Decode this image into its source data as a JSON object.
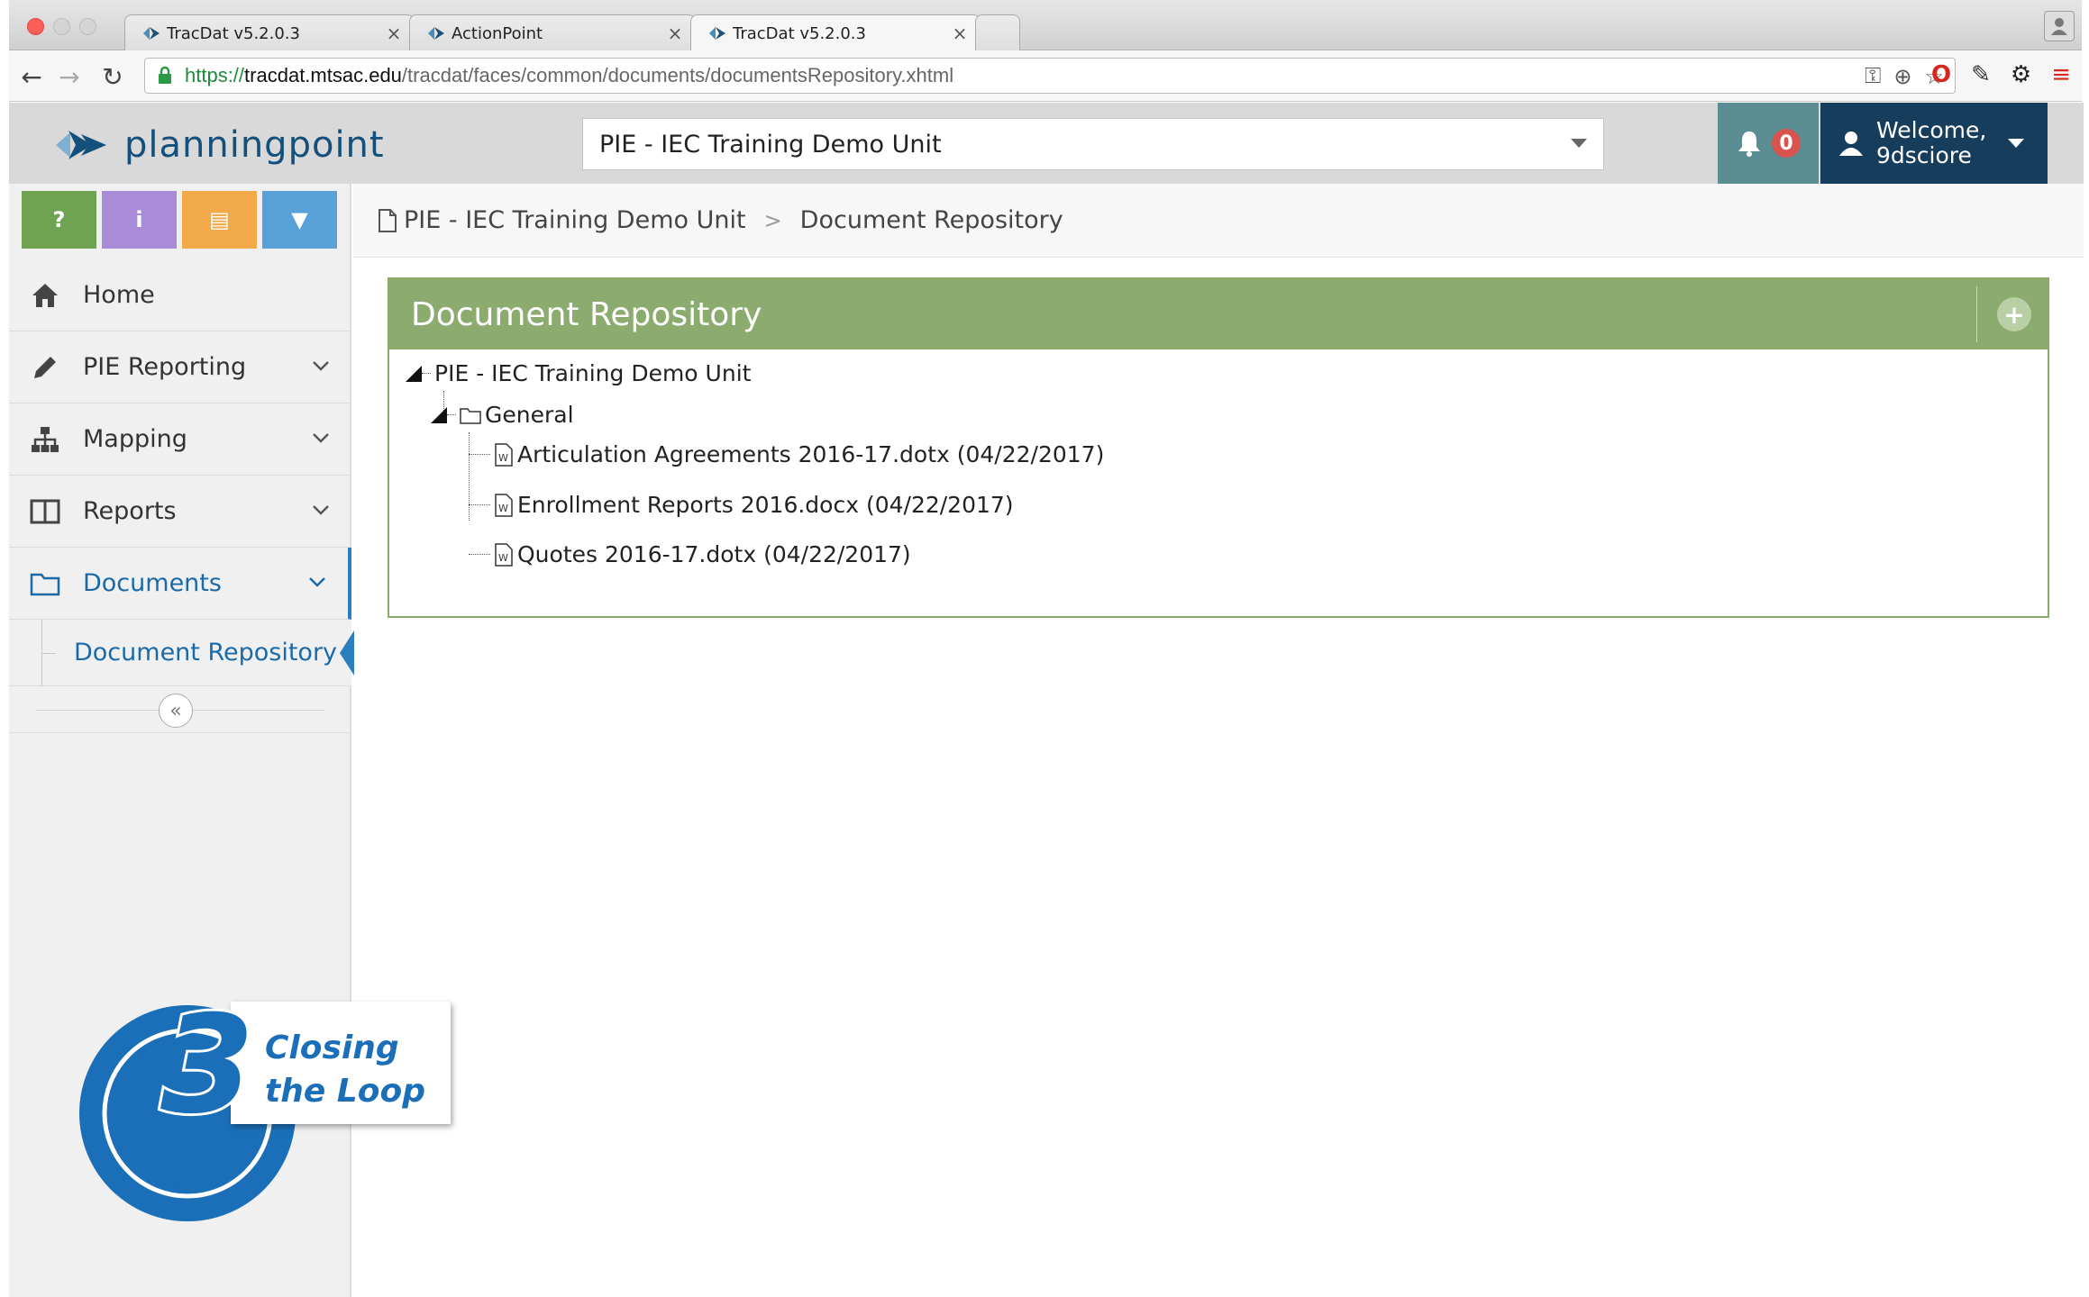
{
  "browser": {
    "tabs": [
      {
        "title": "TracDat v5.2.0.3",
        "active": false
      },
      {
        "title": "ActionPoint",
        "active": false
      },
      {
        "title": "TracDat v5.2.0.3",
        "active": true
      }
    ],
    "url": {
      "scheme": "https://",
      "host": "tracdat.mtsac.edu",
      "path": "/tracdat/faces/common/documents/documentsRepository.xhtml"
    }
  },
  "header": {
    "logo_text": "planningpoint",
    "unit_selected": "PIE - IEC Training Demo Unit",
    "notification_count": "0",
    "welcome_line1": "Welcome,",
    "welcome_line2": "9dsciore"
  },
  "sidebar": {
    "quick_buttons": [
      {
        "icon": "help-icon",
        "glyph": "?"
      },
      {
        "icon": "info-icon",
        "glyph": "i"
      },
      {
        "icon": "notes-icon",
        "glyph": "▤"
      },
      {
        "icon": "filter-icon",
        "glyph": "▼"
      }
    ],
    "items": [
      {
        "label": "Home",
        "icon": "home-icon"
      },
      {
        "label": "PIE Reporting",
        "icon": "pencil-icon"
      },
      {
        "label": "Mapping",
        "icon": "sitemap-icon"
      },
      {
        "label": "Reports",
        "icon": "columns-icon"
      },
      {
        "label": "Documents",
        "icon": "folder-icon"
      }
    ],
    "sub_item": "Document Repository"
  },
  "breadcrumb": {
    "unit": "PIE - IEC Training Demo Unit",
    "separator": ">",
    "page": "Document Repository"
  },
  "panel": {
    "title": "Document Repository",
    "tree": {
      "root": "PIE - IEC Training Demo Unit",
      "folder": "General",
      "files": [
        "Articulation Agreements 2016-17.dotx (04/22/2017)",
        "Enrollment Reports 2016.docx (04/22/2017)",
        "Quotes 2016-17.dotx (04/22/2017)"
      ]
    }
  },
  "badge": {
    "number": "3",
    "line1": "Closing",
    "line2": "the Loop"
  },
  "colors": {
    "panel_header": "#8cab6e",
    "link_blue": "#1a6aaa",
    "welcome_bg": "#173d5c",
    "bell_bg": "#5a8e93",
    "badge_blue": "#1b6fb8"
  }
}
